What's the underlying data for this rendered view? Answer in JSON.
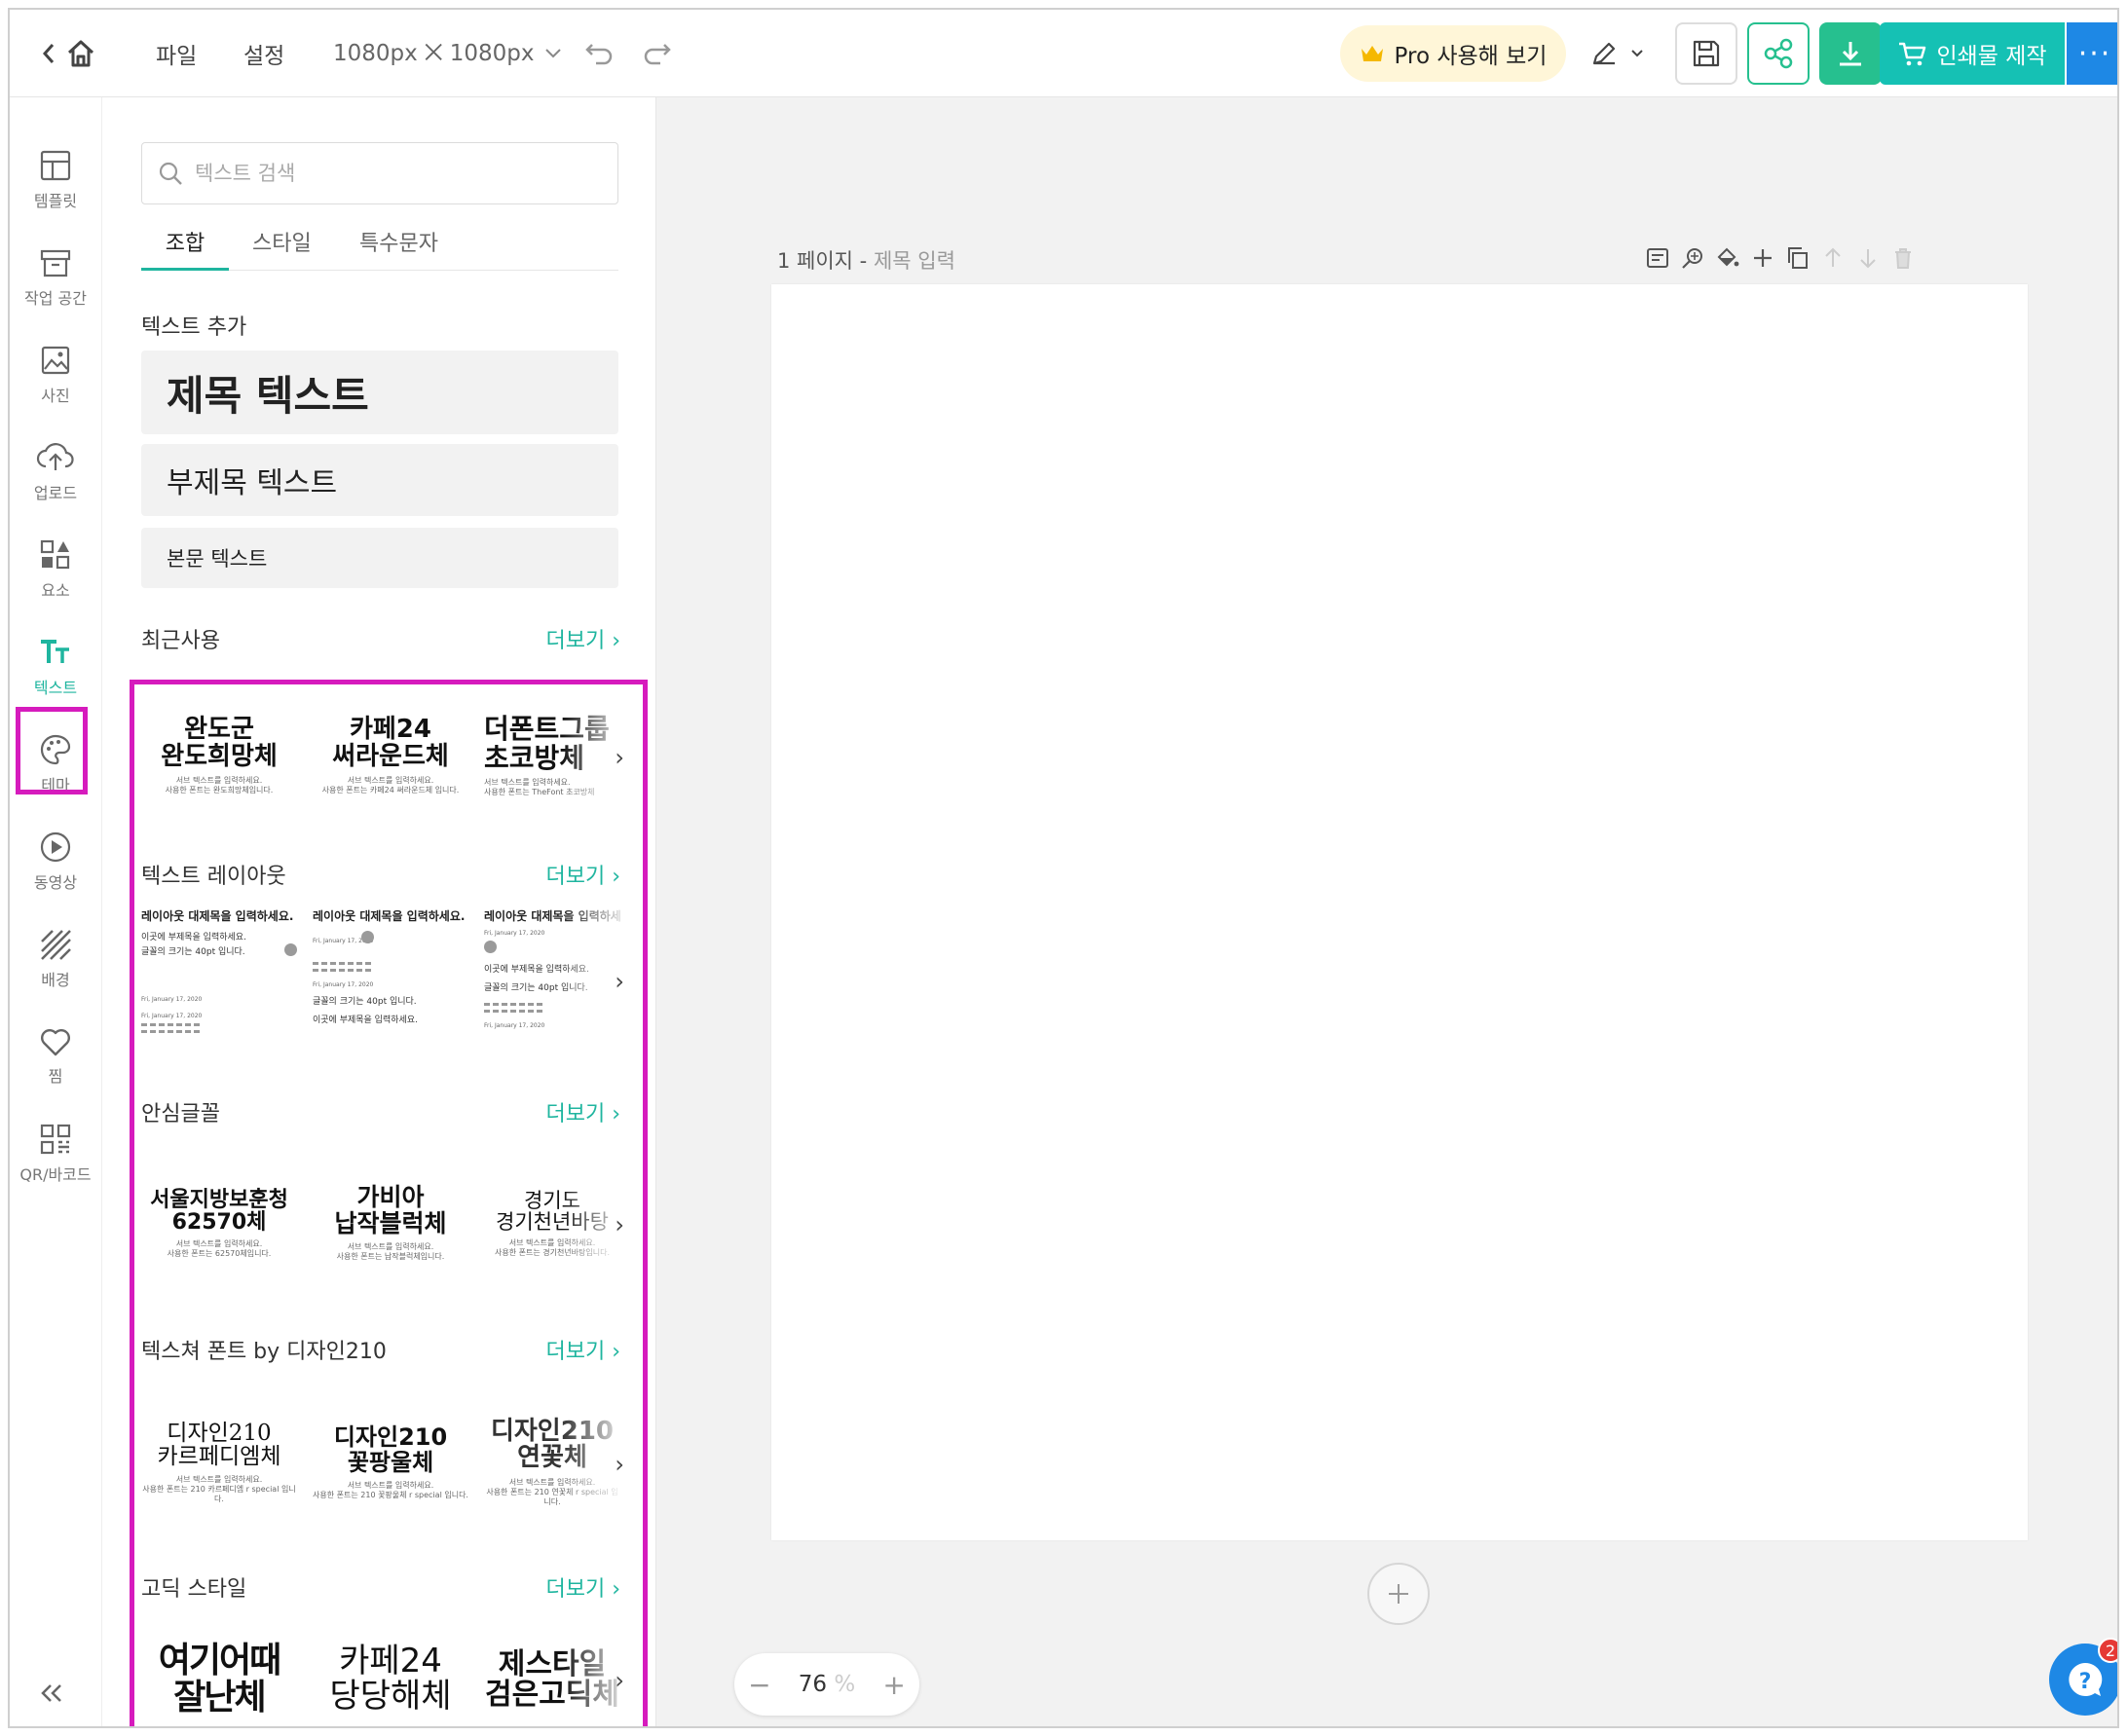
{
  "topbar": {
    "file": "파일",
    "settings": "설정",
    "size": "1080px ⨉ 1080px",
    "pro_label": "Pro 사용해 보기",
    "print_label": "인쇄물 제작",
    "more_label": "···"
  },
  "rail": {
    "items": [
      {
        "label": "템플릿",
        "icon": "template-icon"
      },
      {
        "label": "작업 공간",
        "icon": "workspace-icon"
      },
      {
        "label": "사진",
        "icon": "photo-icon"
      },
      {
        "label": "업로드",
        "icon": "upload-icon"
      },
      {
        "label": "요소",
        "icon": "elements-icon"
      },
      {
        "label": "텍스트",
        "icon": "text-icon"
      },
      {
        "label": "테마",
        "icon": "palette-icon"
      },
      {
        "label": "동영상",
        "icon": "video-icon"
      },
      {
        "label": "배경",
        "icon": "background-icon"
      },
      {
        "label": "찜",
        "icon": "heart-icon"
      },
      {
        "label": "QR/바코드",
        "icon": "qr-icon"
      }
    ],
    "active_index": 5
  },
  "panel": {
    "search_placeholder": "텍스트 검색",
    "tabs": [
      "조합",
      "스타일",
      "특수문자"
    ],
    "add_text_title": "텍스트 추가",
    "heading_text": "제목 텍스트",
    "subheading_text": "부제목 텍스트",
    "body_text": "본문 텍스트",
    "more_label": "더보기",
    "sections": {
      "recent": "최근사용",
      "layout": "텍스트 레이아웃",
      "safe": "안심글꼴",
      "texture": "텍스쳐 폰트 by 디자인210",
      "gothic": "고딕 스타일"
    },
    "recent_thumbs": [
      {
        "main": "완도군\n완도희망체",
        "sub": "서브 텍스트를 입력하세요.\n사용한 폰트는 완도희망체입니다."
      },
      {
        "main": "카페24\n써라운드체",
        "sub": "서브 텍스트를 입력하세요.\n사용한 폰트는 카페24 써라운드체 입니다."
      },
      {
        "main": "더폰트그룹\n초코방체",
        "sub": "서브 텍스트를 입력하세요.\n사용한 폰트는 TheFont 초코방체"
      }
    ],
    "layout_thumbs": [
      {
        "title": "레이아웃 대제목을 입력하세요.",
        "line1": "이곳에 부제목을 입력하세요.",
        "line2": "글꼴의 크기는 40pt 입니다.",
        "date": "Fri, January 17, 2020"
      },
      {
        "title": "레이아웃 대제목을 입력하세요.",
        "line1": "글꼴의 크기는 40pt 입니다.",
        "line2": "이곳에 부제목을 입력하세요.",
        "date": "Fri, January 17, 2020"
      },
      {
        "title": "레이아웃 대제목을 입력하세요.",
        "line1": "이곳에 부제목을 입력하세요.",
        "line2": "글꼴의 크기는 40pt 입니다.",
        "date": "Fri, January 17, 2020"
      }
    ],
    "safe_thumbs": [
      {
        "main": "서울지방보훈청\n62570체",
        "sub": "서브 텍스트를 입력하세요.\n사용한 폰트는 62570체입니다."
      },
      {
        "main": "가비아\n납작블럭체",
        "sub": "서브 텍스트를 입력하세요.\n사용한 폰트는 납작블럭체입니다."
      },
      {
        "main": "경기도\n경기천년바탕",
        "sub": "서브 텍스트를 입력하세요.\n사용한 폰트는 경기천년바탕입니다."
      }
    ],
    "texture_thumbs": [
      {
        "main": "디자인210\n카르페디엠체",
        "sub": "서브 텍스트를 입력하세요.\n사용한 폰트는 210 카르페디엠 r special 입니다."
      },
      {
        "main": "디자인210\n꽃팡울체",
        "sub": "서브 텍스트를 입력하세요.\n사용한 폰트는 210 꽃팡울체 r special 입니다."
      },
      {
        "main": "디자인210\n연꽃체",
        "sub": "서브 텍스트를 입력하세요.\n사용한 폰트는 210 연꽃체 r special 입니다."
      }
    ],
    "gothic_thumbs": [
      {
        "main": "여기어때\n잘난체"
      },
      {
        "main": "카페24\n당당해체"
      },
      {
        "main": "제스타일\n검은고딕체"
      }
    ]
  },
  "canvas": {
    "page_number": "1 페이지 - ",
    "page_title_placeholder": "제목 입력",
    "zoom_value": "76",
    "zoom_unit": "%",
    "help_badge": "2"
  },
  "colors": {
    "accent": "#1fb59f",
    "highlight": "#d61bbd",
    "print": "#15c1b4",
    "more": "#1e88e5"
  }
}
